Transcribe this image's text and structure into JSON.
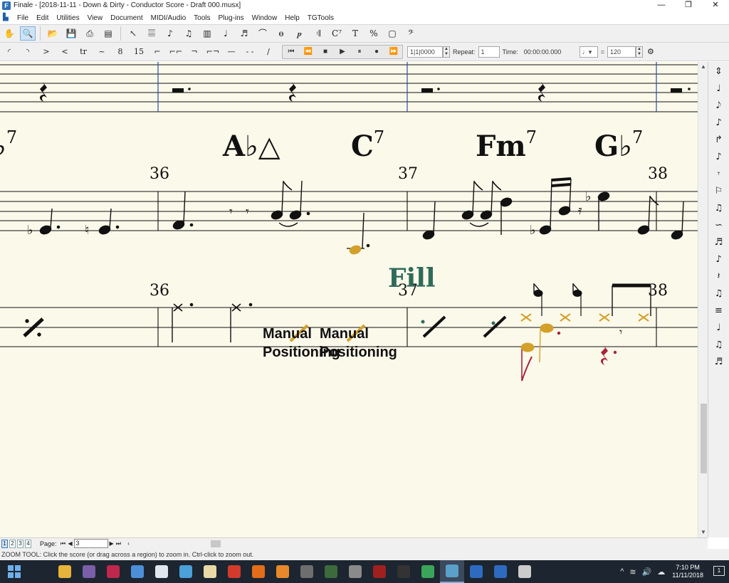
{
  "window": {
    "title": "Finale - [2018-11-11 - Down & Dirty - Conductor Score - Draft 000.musx]",
    "controls": [
      "—",
      "❐",
      "✕"
    ]
  },
  "menu": [
    "File",
    "Edit",
    "Utilities",
    "View",
    "Document",
    "MIDI/Audio",
    "Tools",
    "Plug-ins",
    "Window",
    "Help",
    "TGTools"
  ],
  "toolbar": {
    "main_tools": [
      {
        "name": "hand-grabber-tool",
        "glyph": "✋"
      },
      {
        "name": "zoom-tool",
        "glyph": "🔍",
        "active": true
      },
      {
        "name": "open-file-tool",
        "glyph": "📂"
      },
      {
        "name": "save-tool",
        "glyph": "💾"
      },
      {
        "name": "print-tool",
        "glyph": "⎙"
      },
      {
        "name": "scan-tool",
        "glyph": "▤"
      },
      {
        "name": "selection-tool",
        "glyph": "↖"
      },
      {
        "name": "staff-tool",
        "glyph": "𝄚"
      },
      {
        "name": "simple-entry-tool",
        "glyph": "♪"
      },
      {
        "name": "speedy-entry-tool",
        "glyph": "♫"
      },
      {
        "name": "measure-tool",
        "glyph": "▥"
      },
      {
        "name": "note-entry-tool",
        "glyph": "♩"
      },
      {
        "name": "tuplet-tool",
        "glyph": "♬"
      },
      {
        "name": "smart-shape-tool",
        "glyph": "⌒"
      },
      {
        "name": "articulation-tool",
        "glyph": "ɵ"
      },
      {
        "name": "expression-tool",
        "glyph": "𝆏"
      },
      {
        "name": "repeat-tool",
        "glyph": "𝄇"
      },
      {
        "name": "chord-tool",
        "glyph": "C⁷"
      },
      {
        "name": "text-tool",
        "glyph": "T"
      },
      {
        "name": "resize-tool",
        "glyph": "%"
      },
      {
        "name": "graphics-tool",
        "glyph": "▢"
      },
      {
        "name": "clef-tool",
        "glyph": "𝄢"
      }
    ],
    "smart_shapes": [
      "◜",
      "◝",
      ">",
      "<",
      "tr",
      "~",
      "8",
      "15",
      "⌐",
      "⌐⌐",
      "¬",
      "⌐¬",
      "—",
      "- -",
      "/"
    ],
    "playback": {
      "buttons": [
        "⏮",
        "⏪",
        "■",
        "▶",
        "⏸",
        "●",
        "⏩"
      ],
      "measure_value": "1|1|0000",
      "repeat_label": "Repeat:",
      "repeat_value": "1",
      "time_label": "Time:",
      "time_value": "00:00:00.000",
      "tempo_equals": "=",
      "tempo_value": "120"
    }
  },
  "score": {
    "chords": [
      {
        "root": "♭",
        "ext": "7"
      },
      {
        "root": "A♭△",
        "ext": ""
      },
      {
        "root": "C",
        "ext": "7"
      },
      {
        "root": "Fm",
        "ext": "7"
      },
      {
        "root": "G♭",
        "ext": "7"
      }
    ],
    "measure_numbers_top": [
      "36",
      "37",
      "38"
    ],
    "measure_numbers_bottom": [
      "36",
      "37",
      "38"
    ],
    "expression": "Fill",
    "manual_positioning": [
      "Manual",
      "Manual",
      "Positioning",
      "Positioning"
    ]
  },
  "palette": [
    "⇕",
    "♩",
    "𝅘𝅥𝅮",
    "♪",
    "↱",
    "♪",
    "𝄾",
    "⚐",
    "♫",
    "∽",
    "♬",
    "♪",
    "𝄽",
    "♫",
    "≡",
    "♩",
    "♫",
    "♬"
  ],
  "pagebar": {
    "views": [
      "1",
      "2",
      "3",
      "4"
    ],
    "page_label": "Page:",
    "page_value": "3"
  },
  "status": "ZOOM TOOL: Click the score (or drag across a region) to zoom in. Ctrl-click to zoom out.",
  "taskbar": {
    "apps": [
      {
        "name": "task-view",
        "color": "#1c2530"
      },
      {
        "name": "file-explorer",
        "color": "#e8b33a"
      },
      {
        "name": "photo-app",
        "color": "#7a5ea8"
      },
      {
        "name": "red-app",
        "color": "#c0274c"
      },
      {
        "name": "blue-app",
        "color": "#4c8fd6"
      },
      {
        "name": "doc-app",
        "color": "#dfe6ee"
      },
      {
        "name": "globe-app",
        "color": "#4aa0d8"
      },
      {
        "name": "mail-app",
        "color": "#e9d9a6"
      },
      {
        "name": "paint-app",
        "color": "#d23b2b"
      },
      {
        "name": "firefox",
        "color": "#e36d1b"
      },
      {
        "name": "media-app",
        "color": "#e8882a"
      },
      {
        "name": "ai-app",
        "color": "#6e6e6e"
      },
      {
        "name": "tool-app",
        "color": "#3c6a3c"
      },
      {
        "name": "mic-app",
        "color": "#8a8a8a"
      },
      {
        "name": "film-app",
        "color": "#a02020"
      },
      {
        "name": "cam-app",
        "color": "#333333"
      },
      {
        "name": "shield-app",
        "color": "#3aa55a"
      },
      {
        "name": "finale",
        "color": "#5aa0c8",
        "active": true
      },
      {
        "name": "defender",
        "color": "#2e6ac0"
      },
      {
        "name": "help-app",
        "color": "#2e6ac0"
      },
      {
        "name": "people-app",
        "color": "#cccccc"
      }
    ],
    "tray": [
      "^",
      "≋",
      "🔊",
      "☁"
    ],
    "time": "7:10 PM",
    "date": "11/11/2018",
    "notification": "1"
  },
  "colors": {
    "paper": "#fbf9ea",
    "accent_gold": "#d4a02a",
    "accent_red": "#a8223a",
    "fill_text": "#2f6b5a"
  }
}
